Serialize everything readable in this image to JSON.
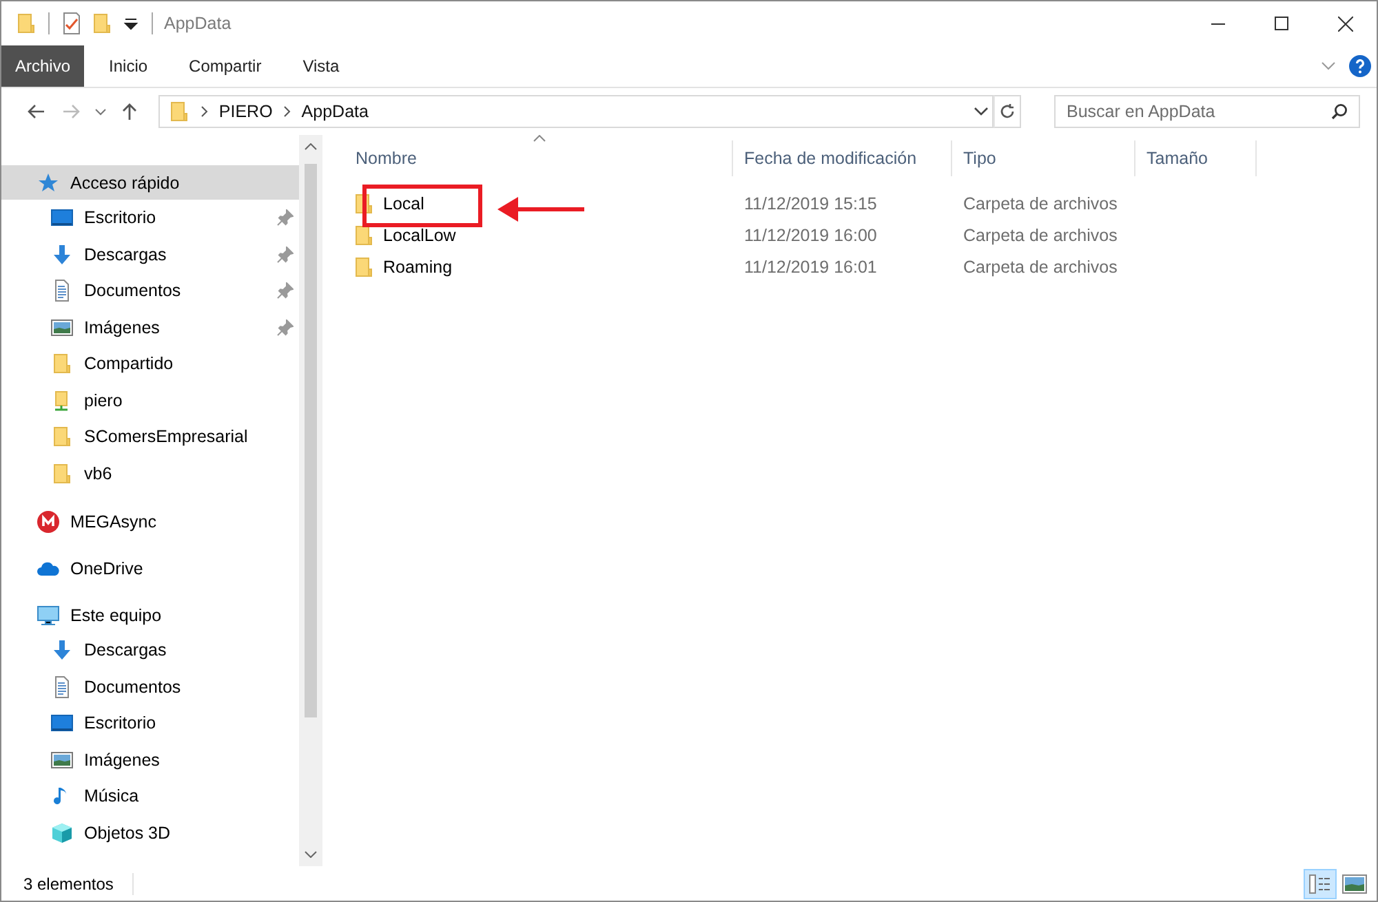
{
  "window": {
    "title": "AppData"
  },
  "quick_access_toolbar": [
    {
      "kind": "folder"
    },
    {
      "kind": "properties"
    },
    {
      "kind": "new-folder"
    },
    {
      "kind": "dropdown"
    }
  ],
  "ribbon": {
    "tabs": [
      {
        "label": "Archivo",
        "kind": "file"
      },
      {
        "label": "Inicio",
        "kind": "tab"
      },
      {
        "label": "Compartir",
        "kind": "tab"
      },
      {
        "label": "Vista",
        "kind": "tab"
      }
    ]
  },
  "address_bar": {
    "path": [
      "PIERO",
      "AppData"
    ]
  },
  "search": {
    "placeholder": "Buscar en AppData"
  },
  "nav": [
    {
      "label": "Acceso rápido",
      "kind": "star",
      "selected": true,
      "children": [
        {
          "label": "Escritorio",
          "kind": "desktop",
          "pinned": true,
          "selected": false
        },
        {
          "label": "Descargas",
          "kind": "download",
          "pinned": true,
          "selected": false
        },
        {
          "label": "Documentos",
          "kind": "document",
          "pinned": true,
          "selected": false
        },
        {
          "label": "Imágenes",
          "kind": "pictures",
          "pinned": true,
          "selected": false
        },
        {
          "label": "Compartido",
          "kind": "folder",
          "pinned": false,
          "selected": false
        },
        {
          "label": "piero",
          "kind": "shared-folder",
          "pinned": false,
          "selected": false
        },
        {
          "label": "SComersEmpresarial",
          "kind": "folder",
          "pinned": false,
          "selected": false
        },
        {
          "label": "vb6",
          "kind": "folder",
          "pinned": false,
          "selected": false
        }
      ]
    },
    {
      "label": "MEGAsync",
      "kind": "mega",
      "selected": false
    },
    {
      "label": "OneDrive",
      "kind": "cloud",
      "selected": false
    },
    {
      "label": "Este equipo",
      "kind": "pc",
      "selected": false,
      "children": [
        {
          "label": "Descargas",
          "kind": "download",
          "selected": false
        },
        {
          "label": "Documentos",
          "kind": "document",
          "selected": false
        },
        {
          "label": "Escritorio",
          "kind": "desktop",
          "selected": false
        },
        {
          "label": "Imágenes",
          "kind": "pictures",
          "selected": false
        },
        {
          "label": "Música",
          "kind": "music",
          "selected": false
        },
        {
          "label": "Objetos 3D",
          "kind": "cube",
          "selected": false
        }
      ]
    }
  ],
  "columns": [
    {
      "label": "Nombre",
      "sorted": true
    },
    {
      "label": "Fecha de modificación",
      "sorted": false
    },
    {
      "label": "Tipo",
      "sorted": false
    },
    {
      "label": "Tamaño",
      "sorted": false
    }
  ],
  "files": [
    {
      "name": "Local",
      "modified": "11/12/2019 15:15",
      "type": "Carpeta de archivos",
      "highlighted": true
    },
    {
      "name": "LocalLow",
      "modified": "11/12/2019 16:00",
      "type": "Carpeta de archivos",
      "highlighted": false
    },
    {
      "name": "Roaming",
      "modified": "11/12/2019 16:01",
      "type": "Carpeta de archivos",
      "highlighted": false
    }
  ],
  "status_bar": {
    "item_count": "3 elementos"
  },
  "views": [
    {
      "kind": "details",
      "selected": true
    },
    {
      "kind": "large-icons",
      "selected": false
    }
  ]
}
